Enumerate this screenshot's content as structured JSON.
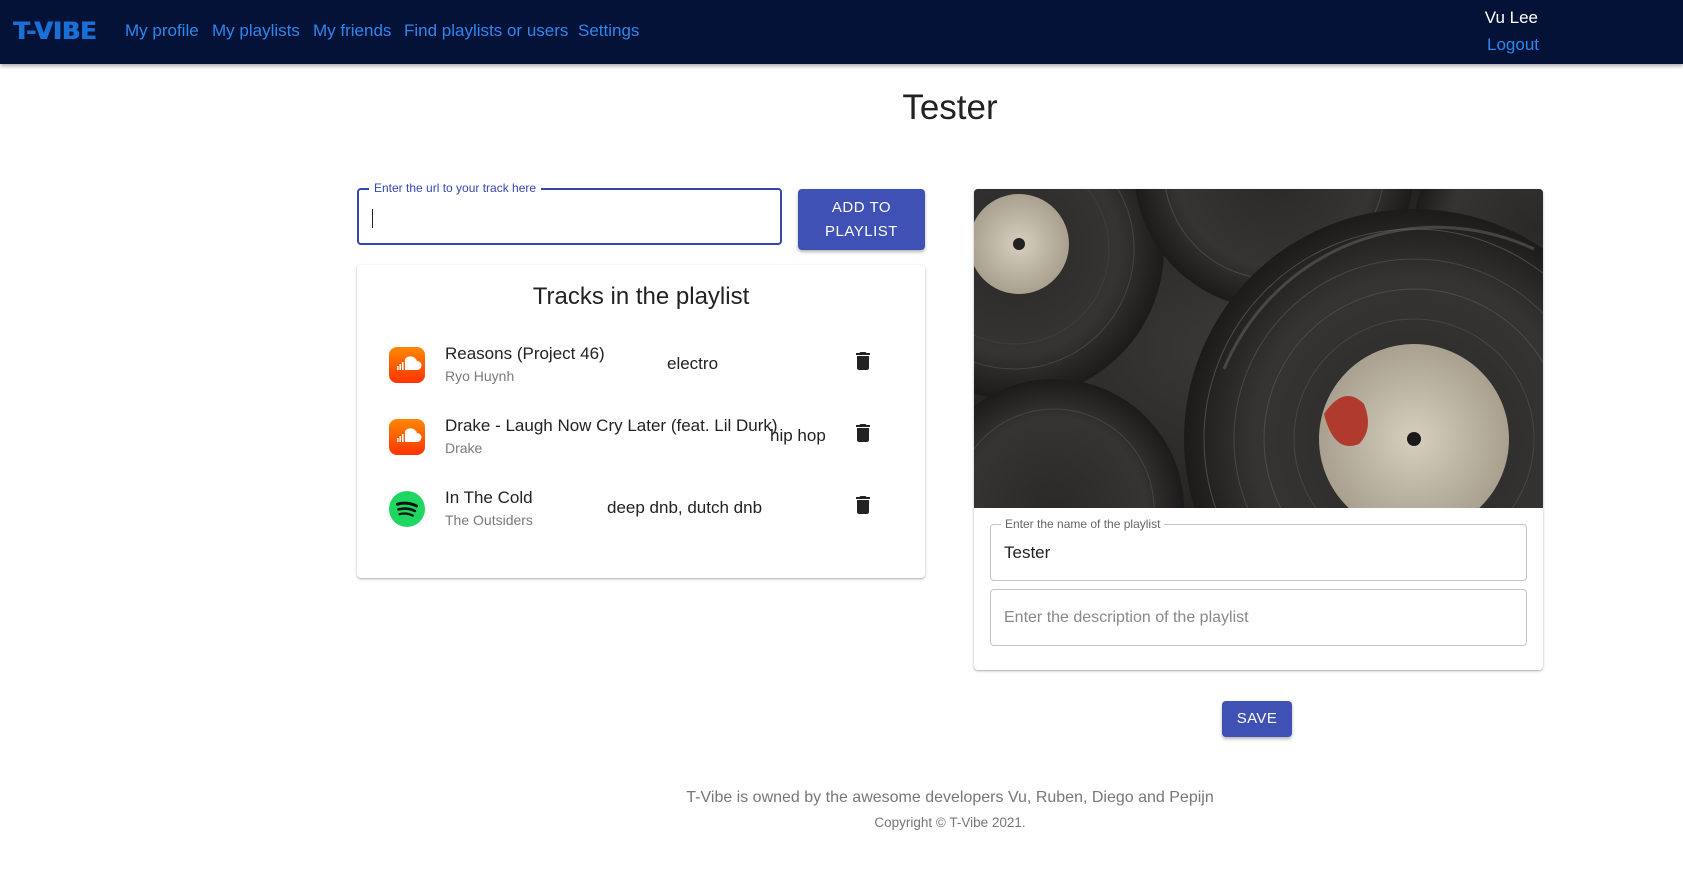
{
  "nav": {
    "logo": "T-VIBE",
    "links": [
      "My profile",
      "My playlists",
      "My friends",
      "Find playlists or users",
      "Settings"
    ],
    "user_name": "Vu Lee",
    "logout": "Logout"
  },
  "page": {
    "title": "Tester"
  },
  "track_input": {
    "label": "Enter the url to your track here",
    "value": "",
    "add_button": "ADD TO PLAYLIST"
  },
  "tracks": {
    "heading": "Tracks in the playlist",
    "items": [
      {
        "title": "Reasons (Project 46)",
        "artist": "Ryo Huynh",
        "genre": "electro",
        "source": "soundcloud-icon"
      },
      {
        "title": "Drake - Laugh Now Cry Later (feat. Lil Durk)",
        "artist": "Drake",
        "genre": "hip hop",
        "source": "soundcloud-icon"
      },
      {
        "title": "In The Cold",
        "artist": "The Outsiders",
        "genre": "deep dnb, dutch dnb",
        "source": "spotify-icon"
      }
    ]
  },
  "playlist": {
    "name_label": "Enter the name of the playlist",
    "name_value": "Tester",
    "description_placeholder": "Enter the description of the playlist",
    "save_button": "SAVE"
  },
  "footer": {
    "text": "T-Vibe is owned by the awesome developers Vu, Ruben, Diego and Pepijn",
    "copyright": "Copyright © T-Vibe 2021."
  },
  "colors": {
    "navbar": "#031236",
    "link": "#2e86f0",
    "primary": "#3f51b5",
    "soundcloud": "#ff5500",
    "spotify": "#1ed760"
  }
}
